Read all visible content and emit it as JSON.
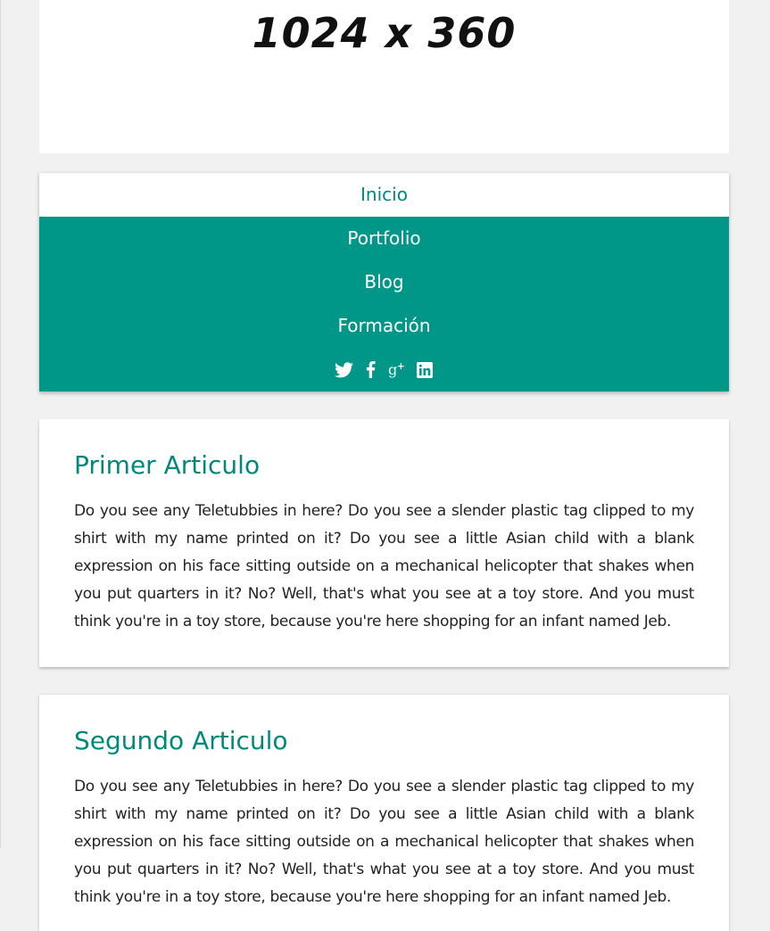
{
  "hero": {
    "placeholder_text": "1024 x 360"
  },
  "nav": {
    "items": [
      {
        "label": "Inicio",
        "active": true
      },
      {
        "label": "Portfolio",
        "active": false
      },
      {
        "label": "Blog",
        "active": false
      },
      {
        "label": "Formación",
        "active": false
      }
    ],
    "social": [
      "twitter-icon",
      "facebook-icon",
      "google-plus-icon",
      "linkedin-icon"
    ]
  },
  "articles": [
    {
      "title": "Primer Articulo",
      "body": "Do you see any Teletubbies in here? Do you see a slender plastic tag clipped to my shirt with my name printed on it? Do you see a little Asian child with a blank expression on his face sitting outside on a mechanical helicopter that shakes when you put quarters in it? No? Well, that's what you see at a toy store. And you must think you're in a toy store, because you're here shopping for an infant named Jeb."
    },
    {
      "title": "Segundo Articulo",
      "body": "Do you see any Teletubbies in here? Do you see a slender plastic tag clipped to my shirt with my name printed on it? Do you see a little Asian child with a blank expression on his face sitting outside on a mechanical helicopter that shakes when you put quarters in it? No? Well, that's what you see at a toy store. And you must think you're in a toy store, because you're here shopping for an infant named Jeb."
    }
  ],
  "colors": {
    "accent": "#009688",
    "accent_text": "#00897b",
    "background": "#f1f1f1"
  }
}
